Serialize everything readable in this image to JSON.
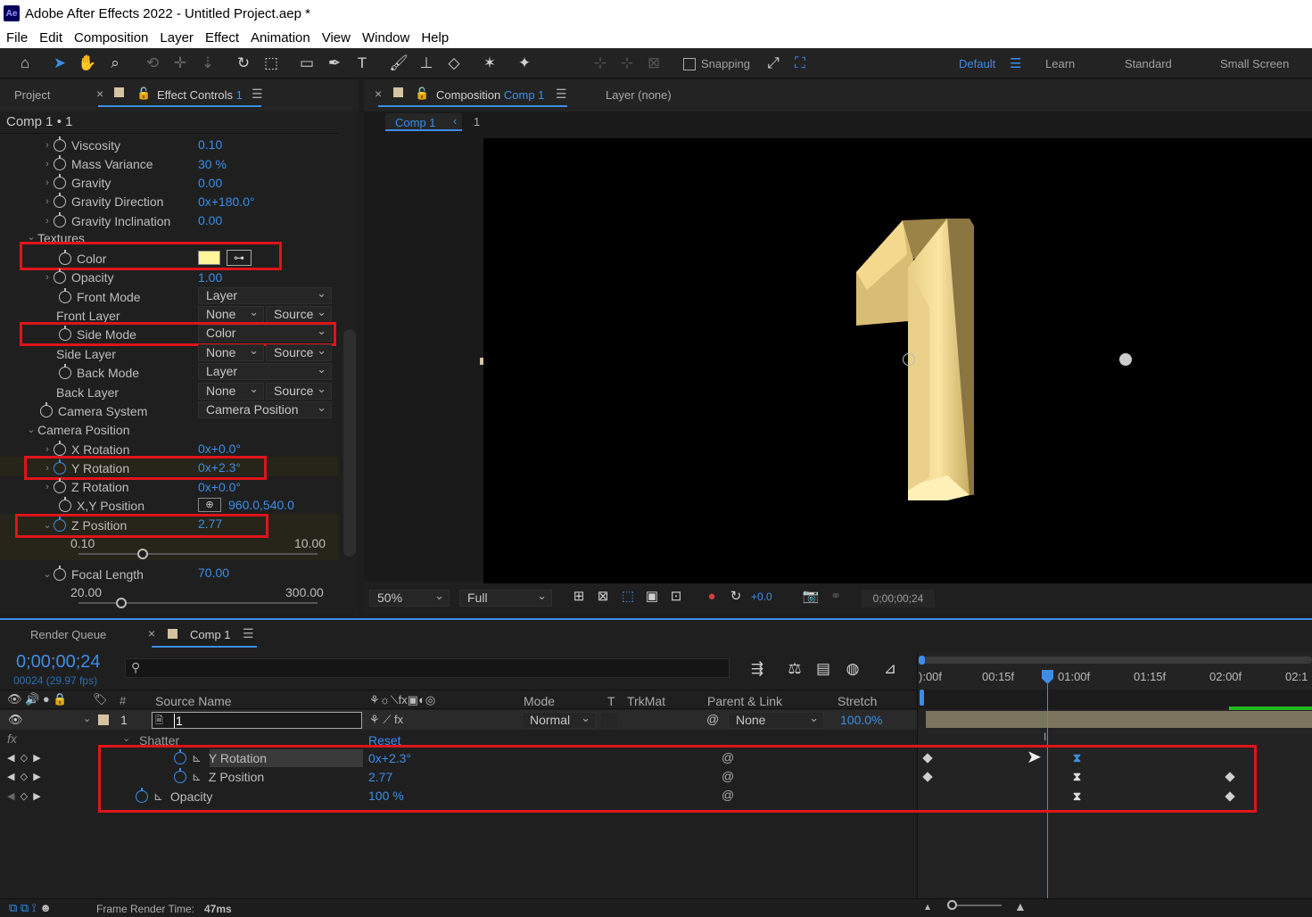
{
  "window": {
    "title": "Adobe After Effects 2022 - Untitled Project.aep *",
    "logo": "Ae"
  },
  "menu": [
    "File",
    "Edit",
    "Composition",
    "Layer",
    "Effect",
    "Animation",
    "View",
    "Window",
    "Help"
  ],
  "toolbar": {
    "snapping_label": "Snapping",
    "workspaces": [
      "Default",
      "Learn",
      "Standard",
      "Small Screen"
    ]
  },
  "effect_panel": {
    "tab_project": "Project",
    "tab_effect": "Effect Controls",
    "tab_effect_layer": "1",
    "comp_label": "Comp 1 • 1",
    "rows": {
      "viscosity": {
        "label": "Viscosity",
        "value": "0.10"
      },
      "mass_variance": {
        "label": "Mass Variance",
        "value": "30 %"
      },
      "gravity": {
        "label": "Gravity",
        "value": "0.00"
      },
      "gravity_direction": {
        "label": "Gravity Direction",
        "value": "0x+180.0°"
      },
      "gravity_inclination": {
        "label": "Gravity Inclination",
        "value": "0.00"
      },
      "textures": {
        "label": "Textures"
      },
      "color": {
        "label": "Color",
        "swatch": "#fff59a"
      },
      "opacity": {
        "label": "Opacity",
        "value": "1.00"
      },
      "front_mode": {
        "label": "Front Mode",
        "value": "Layer"
      },
      "front_layer": {
        "label": "Front Layer",
        "value": "None",
        "value2": "Source"
      },
      "side_mode": {
        "label": "Side Mode",
        "value": "Color"
      },
      "side_layer": {
        "label": "Side Layer",
        "value": "None",
        "value2": "Source"
      },
      "back_mode": {
        "label": "Back Mode",
        "value": "Layer"
      },
      "back_layer": {
        "label": "Back Layer",
        "value": "None",
        "value2": "Source"
      },
      "camera_system": {
        "label": "Camera System",
        "value": "Camera Position"
      },
      "camera_position": {
        "label": "Camera Position"
      },
      "x_rotation": {
        "label": "X Rotation",
        "value": "0x+0.0°"
      },
      "y_rotation": {
        "label": "Y Rotation",
        "value": "0x+2.3°"
      },
      "z_rotation": {
        "label": "Z Rotation",
        "value": "0x+0.0°"
      },
      "xy_position": {
        "label": "X,Y Position",
        "value": "960.0,540.0"
      },
      "z_position": {
        "label": "Z Position",
        "value": "2.77",
        "min": "0.10",
        "max": "10.00",
        "slider_fraction": 0.27
      },
      "focal_length": {
        "label": "Focal Length",
        "value": "70.00",
        "min": "20.00",
        "max": "300.00",
        "slider_fraction": 0.18
      }
    }
  },
  "comp_panel": {
    "tab_label": "Composition",
    "tab_comp": "Comp 1",
    "layer_tab": "Layer (none)",
    "breadcrumb_comp": "Comp 1",
    "breadcrumb_layer": "1",
    "big_number": "1",
    "zoom": "50%",
    "resolution": "Full",
    "exposure": "+0.0",
    "timecode": "0;00;00;24"
  },
  "timeline": {
    "tab_render": "Render Queue",
    "tab_comp": "Comp 1",
    "timecode": "0;00;00;24",
    "frame_info": "00024 (29.97 fps)",
    "search_placeholder": "",
    "headers": {
      "source_name": "Source Name",
      "mode": "Mode",
      "t": "T",
      "trkmat": "TrkMat",
      "parent": "Parent & Link",
      "stretch": "Stretch"
    },
    "layer": {
      "num": "1",
      "name": "1",
      "mode": "Normal",
      "parent": "None",
      "stretch": "100.0%"
    },
    "effect": {
      "name": "Shatter",
      "reset": "Reset"
    },
    "props": [
      {
        "name": "Y Rotation",
        "value": "0x+2.3°"
      },
      {
        "name": "Z Position",
        "value": "2.77"
      },
      {
        "name": "Opacity",
        "value": "100 %"
      }
    ],
    "ruler": [
      "):00f",
      "00:15f",
      "01:00f",
      "01:15f",
      "02:00f",
      "02:1"
    ],
    "status": {
      "label": "Frame Render Time:",
      "value": "47ms"
    }
  }
}
